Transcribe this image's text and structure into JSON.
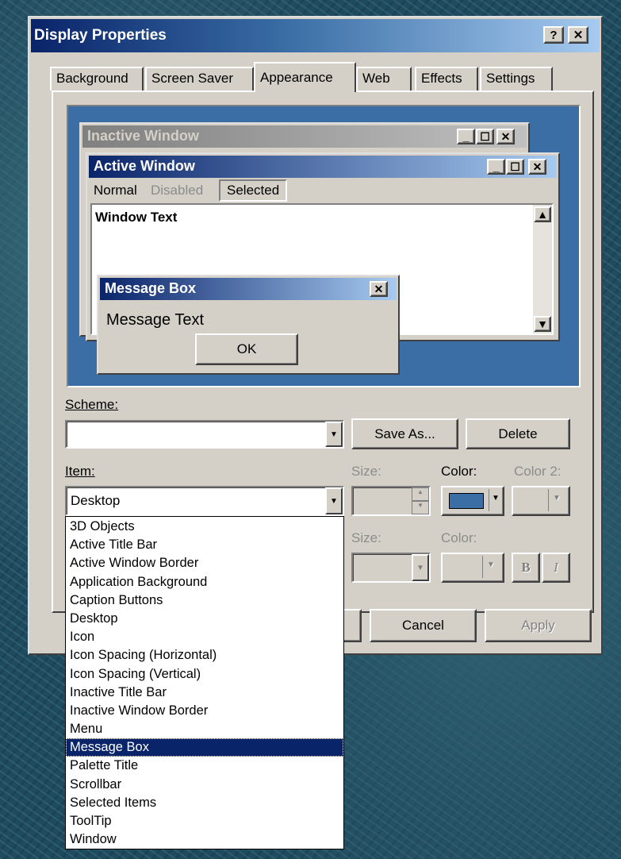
{
  "dialog": {
    "title": "Display Properties",
    "help_button": "?",
    "close_button": "✕"
  },
  "tabs": [
    "Background",
    "Screen Saver",
    "Appearance",
    "Web",
    "Effects",
    "Settings"
  ],
  "active_tab": "Appearance",
  "preview": {
    "inactive_title": "Inactive Window",
    "active_title": "Active Window",
    "menu": {
      "normal": "Normal",
      "disabled": "Disabled",
      "selected": "Selected"
    },
    "window_text": "Window Text",
    "message_box_title": "Message Box",
    "message_text": "Message Text",
    "ok_label": "OK"
  },
  "scheme": {
    "label": "Scheme:",
    "value": "",
    "save_as_label": "Save As...",
    "delete_label": "Delete"
  },
  "item": {
    "label": "Item:",
    "value": "Desktop",
    "size_label": "Size:",
    "color_label": "Color:",
    "color2_label": "Color 2:",
    "font_size_label": "Size:",
    "font_color_label": "Color:",
    "bold_label": "B",
    "italic_label": "I",
    "color_swatch": "#3a6ea5",
    "options": [
      "3D Objects",
      "Active Title Bar",
      "Active Window Border",
      "Application Background",
      "Caption Buttons",
      "Desktop",
      "Icon",
      "Icon Spacing (Horizontal)",
      "Icon Spacing (Vertical)",
      "Inactive Title Bar",
      "Inactive Window Border",
      "Menu",
      "Message Box",
      "Palette Title",
      "Scrollbar",
      "Selected Items",
      "ToolTip",
      "Window"
    ],
    "highlighted": "Message Box"
  },
  "footer": {
    "cancel_label": "Cancel",
    "apply_label": "Apply"
  }
}
